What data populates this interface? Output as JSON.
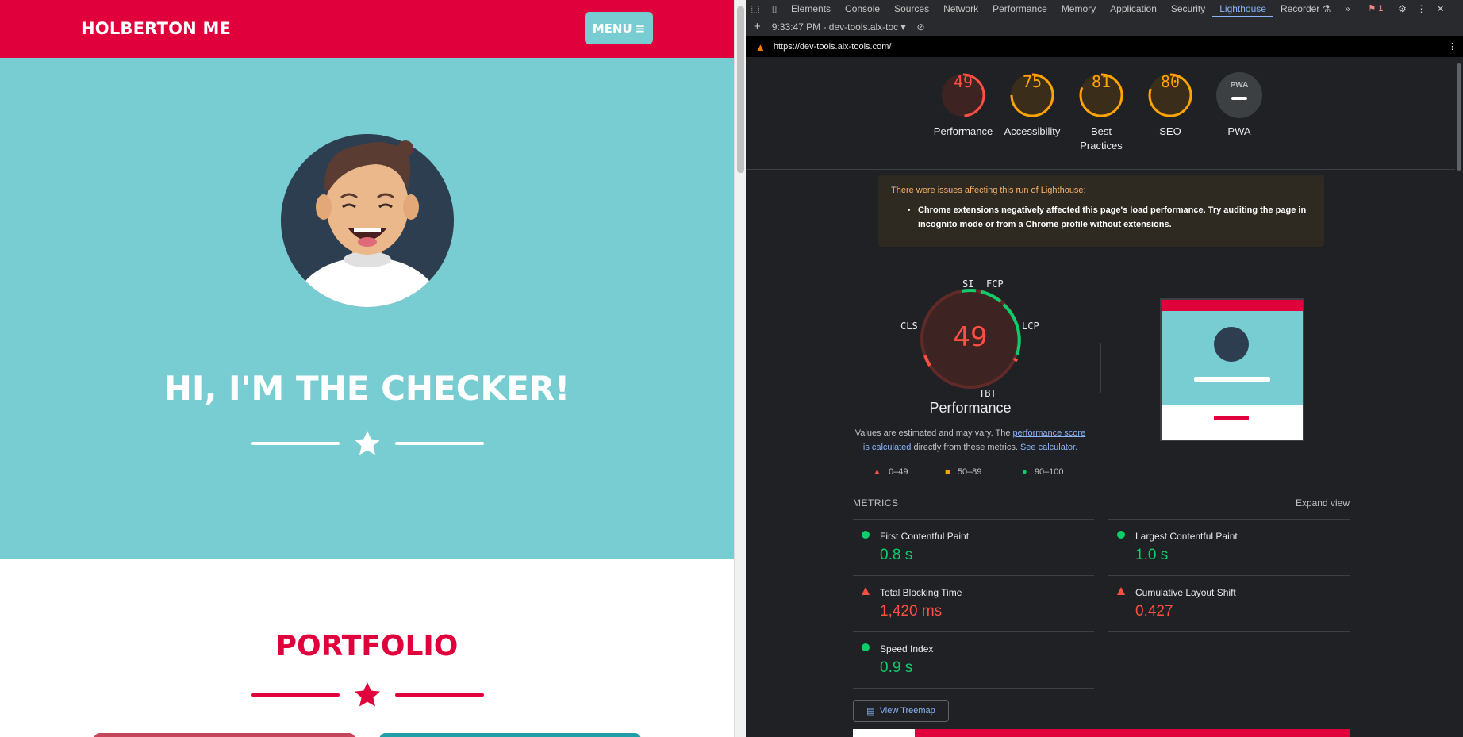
{
  "site": {
    "brand": "HOLBERTON ME",
    "menu_label": "MENU",
    "hero_title": "HI, I'M THE CHECKER!",
    "portfolio_title": "PORTFOLIO",
    "colors": {
      "primary": "#e0003b",
      "teal": "#78cdd2"
    }
  },
  "devtools": {
    "tabs": [
      "Elements",
      "Console",
      "Sources",
      "Network",
      "Performance",
      "Memory",
      "Application",
      "Security",
      "Lighthouse",
      "Recorder"
    ],
    "active_tab": "Lighthouse",
    "issues_count": "1",
    "report_time": "9:33:47 PM - dev-tools.alx-toc",
    "url": "https://dev-tools.alx-tools.com/",
    "categories": [
      {
        "label": "Performance",
        "score": 49,
        "status": "fail"
      },
      {
        "label": "Accessibility",
        "score": 75,
        "status": "average"
      },
      {
        "label": "Best Practices",
        "score": 81,
        "status": "average"
      },
      {
        "label": "SEO",
        "score": 80,
        "status": "average"
      },
      {
        "label": "PWA",
        "score": "",
        "status": "na"
      }
    ],
    "pwa_badge": "PWA",
    "warning": {
      "title": "There were issues affecting this run of Lighthouse:",
      "items": [
        "Chrome extensions negatively affected this page's load performance. Try auditing the page in incognito mode or from a Chrome profile without extensions."
      ]
    },
    "perf_gauge": {
      "score": 49,
      "label": "Performance",
      "metric_labels": {
        "si": "SI",
        "fcp": "FCP",
        "lcp": "LCP",
        "tbt": "TBT",
        "cls": "CLS"
      }
    },
    "description": {
      "prefix": "Values are estimated and may vary. The ",
      "link1": "performance score is calculated",
      "middle": " directly from these metrics. ",
      "link2": "See calculator."
    },
    "legend": [
      "0–49",
      "50–89",
      "90–100"
    ],
    "metrics_header": "METRICS",
    "expand_view": "Expand view",
    "metrics": [
      {
        "name": "First Contentful Paint",
        "value": "0.8 s",
        "status": "pass"
      },
      {
        "name": "Largest Contentful Paint",
        "value": "1.0 s",
        "status": "pass"
      },
      {
        "name": "Total Blocking Time",
        "value": "1,420 ms",
        "status": "fail"
      },
      {
        "name": "Cumulative Layout Shift",
        "value": "0.427",
        "status": "fail"
      },
      {
        "name": "Speed Index",
        "value": "0.9 s",
        "status": "pass"
      }
    ],
    "treemap_label": "View Treemap",
    "colors": {
      "fail": "#ff4e42",
      "average": "#ffa400",
      "pass": "#0cce6b",
      "link": "#8ab4f8"
    }
  }
}
